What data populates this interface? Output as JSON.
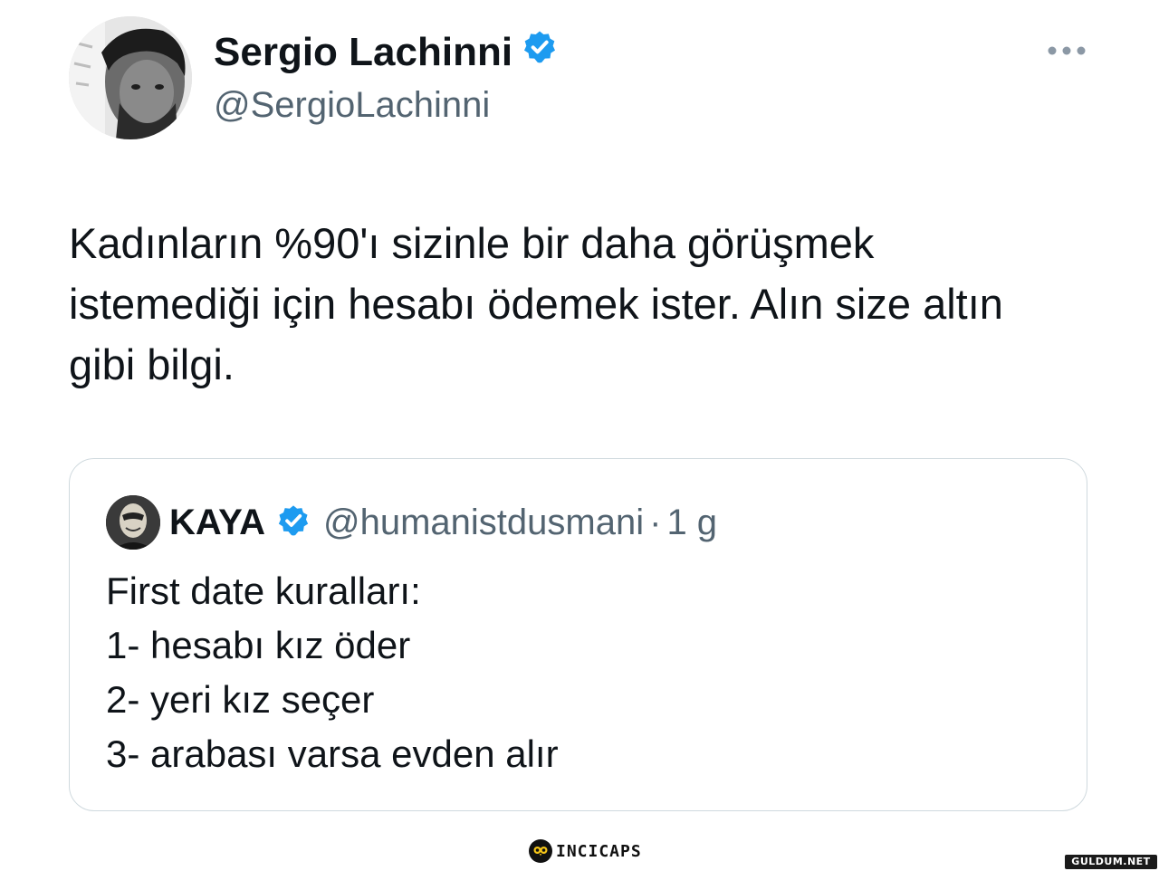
{
  "author": {
    "display_name": "Sergio Lachinni",
    "handle": "@SergioLachinni",
    "verified": true
  },
  "tweet": {
    "text": "Kadınların %90'ı sizinle bir daha görüşmek istemediği için hesabı ödemek ister. Alın size altın gibi bilgi."
  },
  "quoted_tweet": {
    "display_name": "KAYA",
    "handle": "@humanistdusmani",
    "separator": "·",
    "time": "1 g",
    "verified": true,
    "lines": [
      "First date kuralları:",
      "1- hesabı kız öder",
      "2- yeri kız seçer",
      "3- arabası varsa evden alır"
    ]
  },
  "watermarks": {
    "center": "INCICAPS",
    "corner": "GULDUM.NET"
  },
  "colors": {
    "verified_blue": "#1d9bf0",
    "secondary_text": "#536471",
    "border": "#cfd9de"
  },
  "icons": {
    "more": "more-horizontal-icon",
    "verified": "verified-badge-icon"
  }
}
